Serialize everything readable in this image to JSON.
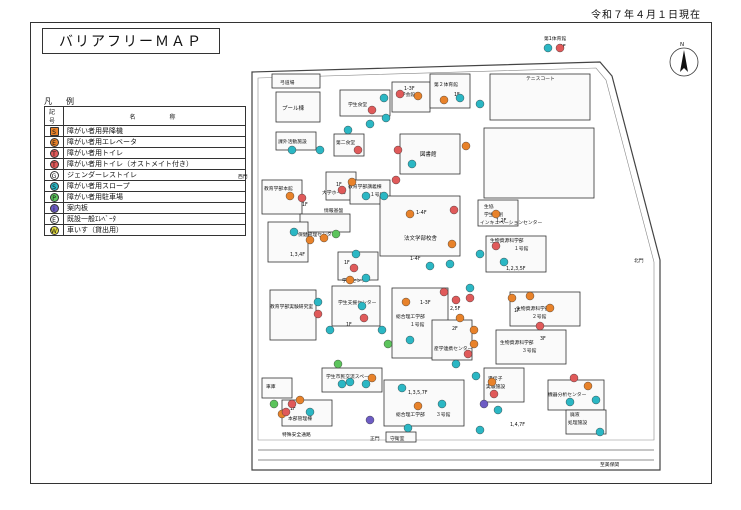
{
  "date_line": "令和７年４月１日現在",
  "title": "バリアフリーＭＡＰ",
  "legend": {
    "heading": "凡　例",
    "col_symbol": "記号",
    "col_name": "名　　　称",
    "items": [
      {
        "symbol": "S",
        "color": "#e8822a",
        "shape": "square",
        "name": "障がい者用昇降機"
      },
      {
        "symbol": "E",
        "color": "#e8822a",
        "shape": "circle",
        "name": "障がい者用エレベータ"
      },
      {
        "symbol": "T",
        "color": "#e05a5a",
        "shape": "circle",
        "name": "障がい者用トイレ"
      },
      {
        "symbol": "T",
        "color": "#e05a5a",
        "shape": "circle",
        "name": "障がい者用トイレ（オストメイト付き）"
      },
      {
        "symbol": "G",
        "color": "#ffffff",
        "shape": "circle",
        "name": "ジェンダーレストイレ"
      },
      {
        "symbol": "S",
        "color": "#2bb7c4",
        "shape": "circle",
        "name": "障がい者用スロープ"
      },
      {
        "symbol": "P",
        "color": "#5cc45c",
        "shape": "circle",
        "name": "障がい者用駐車場"
      },
      {
        "symbol": "i",
        "color": "#6d5cc4",
        "shape": "circle",
        "name": "案内板"
      },
      {
        "symbol": "E",
        "color": "#ffffff",
        "shape": "circle",
        "name": "既設一般ｴﾚﾍﾞｰﾀ"
      },
      {
        "symbol": "W",
        "color": "#e8e040",
        "shape": "circle",
        "name": "車いす（貸出用）"
      }
    ]
  },
  "north_label": "N",
  "labels": {
    "b1": "弓道場",
    "b2": "プール棟",
    "b3": "学生食堂",
    "b4": "大学会館",
    "b5": "第２体育館",
    "b6": "第1体育館",
    "b7": "テニスコート",
    "b8": "課外活動施設",
    "b9": "第二食堂",
    "b10": "図書館",
    "b11": "教育学部本館",
    "b12": "大学ホール",
    "b13": "教育学部講義棟",
    "b14": "１号館",
    "b15": "保健管理センター",
    "b16": "情報基盤",
    "b17": "法文学部校舎",
    "b18": "生協",
    "b19": "学生協創",
    "b20": "インキュベーションセンター",
    "b21": "生物資源科学部",
    "b22": "１号館",
    "b23": "学生センター",
    "b24": "学生支援センター",
    "b25": "教育学部実験研究室",
    "b26": "総合理工学部",
    "b27": "１号館",
    "b28": "産学連携センター",
    "b29": "生物資源科学部",
    "b30": "２号館",
    "b31": "生物資源科学部",
    "b32": "３号館",
    "b33": "学生市民交流スペース",
    "b34": "車庫",
    "b35": "本部管理棟",
    "b36": "総合理工学部",
    "b37": "３号館",
    "b38": "遺伝子",
    "b39": "実験施設",
    "b40": "機器分析センター",
    "b41": "廃液",
    "b42": "処理施設",
    "b43": "守衛室",
    "b44": "正門",
    "b45": "特殊安全通路",
    "b46": "至美保関",
    "b47": "西門",
    "b48": "北門",
    "f1": "1F",
    "f2": "1-3F",
    "f3": "1F",
    "f4": "1F",
    "f5": "1F",
    "f6": "1-4F",
    "f7": "1-4F",
    "f8": "1,3,4F",
    "f9": "1F",
    "f10": "1,2F",
    "f11": "1,2,3,5F",
    "f12": "1-3F",
    "f13": "2,5F",
    "f14": "1F",
    "f15": "2F",
    "f16": "1F",
    "f17": "1,3,5,7F",
    "f18": "1F",
    "f19": "1,4,7F",
    "f20": "3F"
  },
  "markers_note": "colored accessibility markers placed on campus map"
}
